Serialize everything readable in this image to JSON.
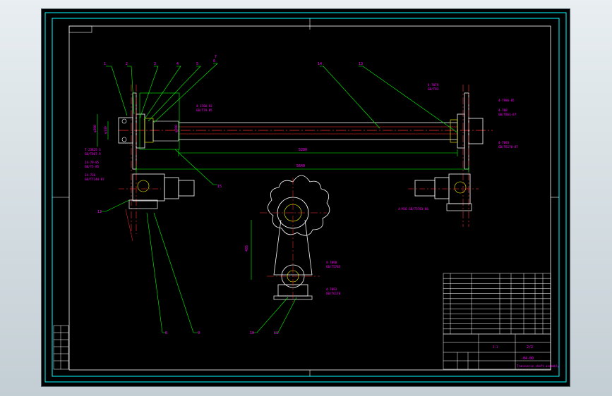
{
  "drawing": {
    "title_block": {
      "sheet_label": "2/2",
      "drawing_number": "-04-00",
      "name": "Transverse shaft assembly",
      "note_label": "2:1"
    },
    "dimensions": {
      "shaft_span": "5280",
      "overall_span": "5640",
      "gear_height": "485",
      "hub_dia": "φ600",
      "bore_a": "φ300",
      "bore_b": "φ140"
    },
    "balloons": [
      "1",
      "2",
      "3",
      "4",
      "5",
      "6",
      "7",
      "8",
      "9",
      "10",
      "11",
      "12",
      "13",
      "14",
      "15"
    ],
    "callouts": {
      "left_upper": "4-1760-93",
      "left_upper_b": "GB/T79-85",
      "left_mid_a": "T-23825-3",
      "left_mid_b": "GB/T887-9",
      "left_low_a": "24-79-85",
      "left_low_b": "GB/T5-85",
      "left_low_c": "24-736",
      "left_low_d": "GB/T7244-87",
      "right_a": "4-7986-85",
      "right_b": "4-708",
      "right_c": "GB/T861-87",
      "right_d": "4-7093",
      "right_e": "GB/T6170-87",
      "right_base": "4-M16 GB/T5783-86",
      "gear_a": "4-7090",
      "gear_b": "GB/T5783",
      "gear_c": "4-7093",
      "gear_d": "GB/T6170",
      "top_right_a": "4-7079",
      "top_right_b": "GB/T93"
    },
    "parts_list_rows": 12
  },
  "colors": {
    "background": "#000000",
    "frame": "#00ffff",
    "inner_frame": "#ffffff",
    "line": "#ffffff",
    "center": "#ff3030",
    "dimension": "#00ff00",
    "leader": "#00ff00",
    "text": "#ff00ff",
    "hidden": "#ffff00"
  }
}
